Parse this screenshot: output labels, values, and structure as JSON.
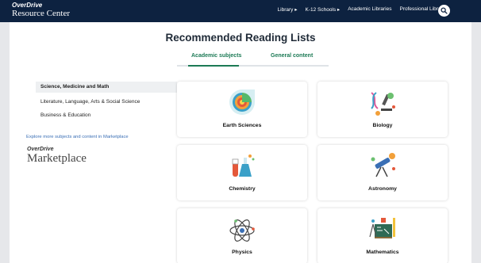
{
  "header": {
    "brand_top": "OverDrive",
    "brand_bottom": "Resource Center",
    "nav": [
      "Library ▸",
      "K-12 Schools ▸",
      "Academic Libraries",
      "Professional Libraries"
    ],
    "search_icon": "search-icon"
  },
  "main": {
    "title": "Recommended Reading Lists",
    "tabs": [
      {
        "label": "Academic subjects",
        "active": true
      },
      {
        "label": "General content",
        "active": false
      }
    ]
  },
  "sidebar": {
    "items": [
      {
        "label": "Science, Medicine and Math",
        "active": true
      },
      {
        "label": "Literature, Language, Arts & Social Science",
        "active": false
      },
      {
        "label": "Business & Education",
        "active": false
      }
    ],
    "explore_link": "Explore more subjects and content in Marketplace",
    "marketplace_top": "OverDrive",
    "marketplace_bottom": "Marketplace"
  },
  "cards": [
    {
      "label": "Earth Sciences",
      "icon": "earth-sciences-icon"
    },
    {
      "label": "Biology",
      "icon": "biology-icon"
    },
    {
      "label": "Chemistry",
      "icon": "chemistry-icon"
    },
    {
      "label": "Astronomy",
      "icon": "astronomy-icon"
    },
    {
      "label": "Physics",
      "icon": "physics-icon"
    },
    {
      "label": "Mathematics",
      "icon": "mathematics-icon"
    }
  ],
  "colors": {
    "header_bg": "#0d2240",
    "accent": "#1c7a55",
    "link": "#3a6fb5"
  }
}
